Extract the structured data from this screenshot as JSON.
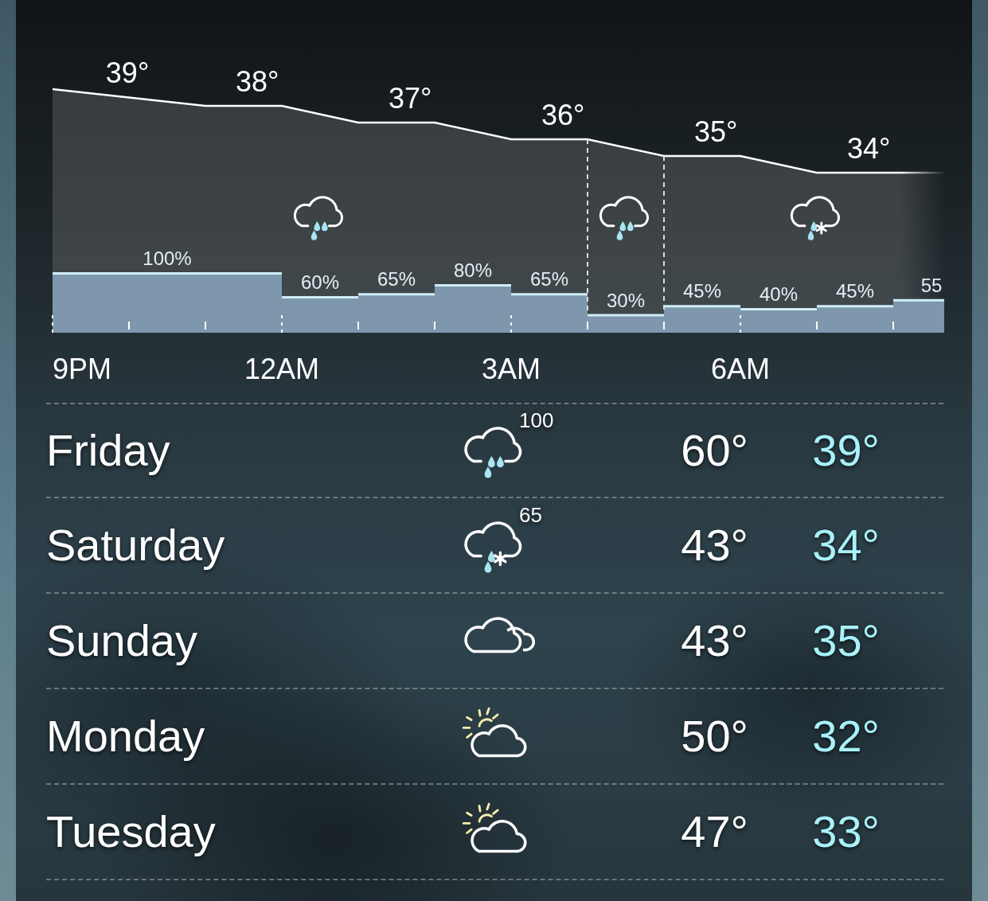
{
  "hourly": {
    "temperatures": [
      {
        "label": "39°"
      },
      {
        "label": "38°"
      },
      {
        "label": "37°"
      },
      {
        "label": "36°"
      },
      {
        "label": "35°"
      },
      {
        "label": "34°"
      }
    ],
    "precipitation": [
      {
        "label": "100%",
        "selected": false
      },
      {
        "selected": false
      },
      {
        "selected": false
      },
      {
        "label": "60%",
        "selected": false
      },
      {
        "label": "65%",
        "selected": false
      },
      {
        "label": "80%",
        "selected": false
      },
      {
        "label": "65%",
        "selected": false
      },
      {
        "label": "30%",
        "selected": true
      },
      {
        "label": "45%",
        "selected": false
      },
      {
        "label": "40%",
        "selected": false
      },
      {
        "label": "45%",
        "selected": false
      },
      {
        "label": "55",
        "selected": false
      }
    ],
    "conditions": [
      {
        "kind": "rain"
      },
      {
        "kind": "rain"
      },
      {
        "kind": "sleet"
      }
    ],
    "times": [
      "9PM",
      "12AM",
      "3AM",
      "6AM"
    ]
  },
  "daily": [
    {
      "day": "Friday",
      "kind": "rain",
      "precipitation": "100",
      "high": "60°",
      "low": "39°"
    },
    {
      "day": "Saturday",
      "kind": "sleet",
      "precipitation": "65",
      "high": "43°",
      "low": "34°"
    },
    {
      "day": "Sunday",
      "kind": "cloudy",
      "high": "43°",
      "low": "35°"
    },
    {
      "day": "Monday",
      "kind": "partly_sunny",
      "high": "50°",
      "low": "32°"
    },
    {
      "day": "Tuesday",
      "kind": "partly_sunny",
      "high": "47°",
      "low": "33°"
    }
  ]
}
